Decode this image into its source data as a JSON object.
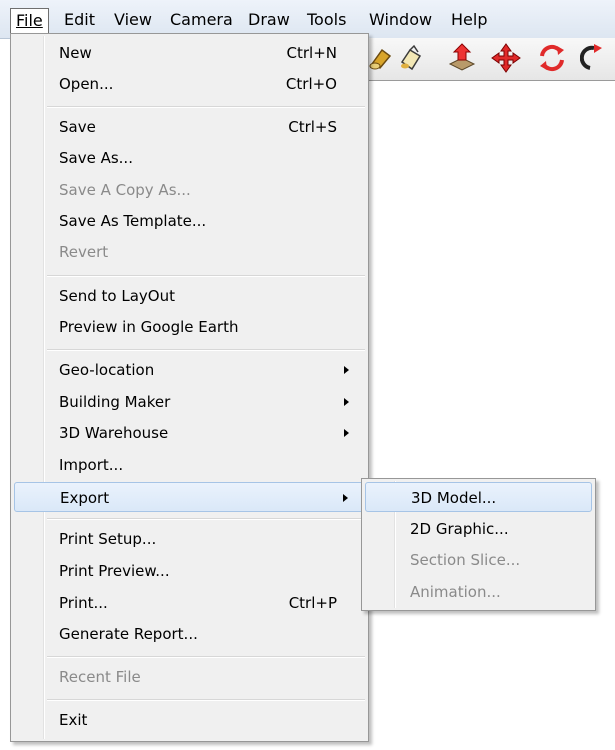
{
  "menubar": {
    "items": [
      {
        "label": "File",
        "mnemonic": "F"
      },
      {
        "label": "Edit",
        "mnemonic": "E"
      },
      {
        "label": "View",
        "mnemonic": "V"
      },
      {
        "label": "Camera",
        "mnemonic": "C"
      },
      {
        "label": "Draw",
        "mnemonic": "r"
      },
      {
        "label": "Tools",
        "mnemonic": "T"
      },
      {
        "label": "Window",
        "mnemonic": "W"
      },
      {
        "label": "Help",
        "mnemonic": "H"
      }
    ]
  },
  "toolbar": {
    "icons": [
      "paint-bucket-icon",
      "push-pull-icon",
      "move-icon",
      "rotate-icon",
      "follow-me-icon"
    ]
  },
  "file_menu": {
    "new": {
      "label": "New",
      "shortcut": "Ctrl+N"
    },
    "open": {
      "label": "Open...",
      "shortcut": "Ctrl+O"
    },
    "save": {
      "label": "Save",
      "shortcut": "Ctrl+S"
    },
    "save_as": {
      "label": "Save As..."
    },
    "save_copy_as": {
      "label": "Save A Copy As..."
    },
    "save_as_template": {
      "label": "Save As Template..."
    },
    "revert": {
      "label": "Revert"
    },
    "send_to_layout": {
      "label": "Send to LayOut"
    },
    "preview_google_earth": {
      "label": "Preview in Google Earth"
    },
    "geo_location": {
      "label": "Geo-location"
    },
    "building_maker": {
      "label": "Building Maker"
    },
    "warehouse": {
      "label": "3D Warehouse"
    },
    "import": {
      "label": "Import..."
    },
    "export": {
      "label": "Export"
    },
    "print_setup": {
      "label": "Print Setup..."
    },
    "print_preview": {
      "label": "Print Preview..."
    },
    "print": {
      "label": "Print...",
      "shortcut": "Ctrl+P"
    },
    "generate_report": {
      "label": "Generate Report..."
    },
    "recent_file": {
      "label": "Recent File"
    },
    "exit": {
      "label": "Exit"
    }
  },
  "export_submenu": {
    "model_3d": {
      "label": "3D Model..."
    },
    "graphic_2d": {
      "label": "2D Graphic..."
    },
    "section_slice": {
      "label": "Section Slice..."
    },
    "animation": {
      "label": "Animation..."
    }
  },
  "colors": {
    "highlight": "#dae8f8",
    "disabled_text": "#8a8a8a",
    "menu_bg": "#f0f0f0"
  }
}
